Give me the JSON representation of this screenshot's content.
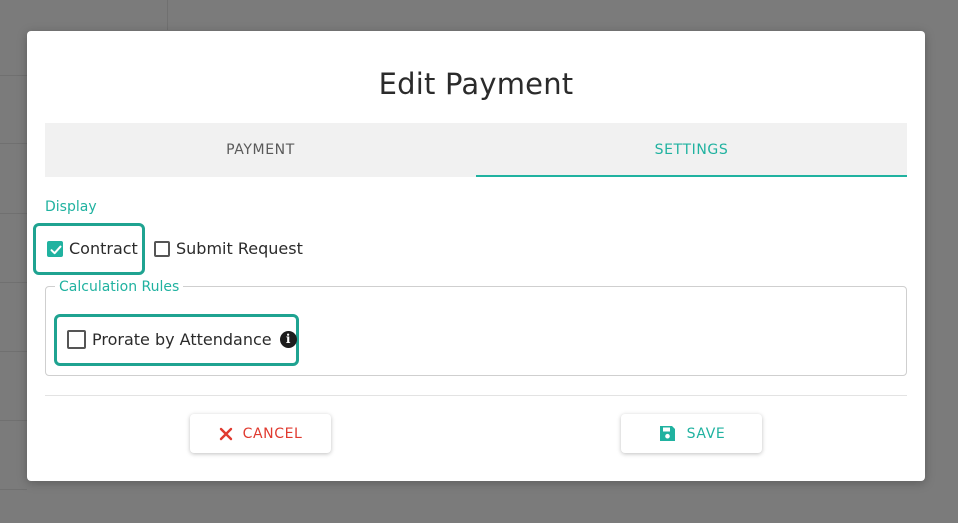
{
  "dialog": {
    "title": "Edit Payment",
    "tabs": [
      {
        "label": "PAYMENT",
        "active": false
      },
      {
        "label": "SETTINGS",
        "active": true
      }
    ],
    "display_section": {
      "label": "Display",
      "options": [
        {
          "label": "Contract",
          "checked": true
        },
        {
          "label": "Submit Request",
          "checked": false
        }
      ]
    },
    "calculation_rules": {
      "label": "Calculation Rules",
      "options": [
        {
          "label": "Prorate by Attendance",
          "checked": false,
          "info_icon": "info-circle-icon"
        }
      ]
    },
    "buttons": {
      "cancel_label": "CANCEL",
      "cancel_icon": "close-icon",
      "save_label": "SAVE",
      "save_icon": "floppy-disk-icon"
    }
  },
  "colors": {
    "accent": "#20b2a0",
    "danger": "#e03a2f",
    "highlight": "#1fa391"
  }
}
